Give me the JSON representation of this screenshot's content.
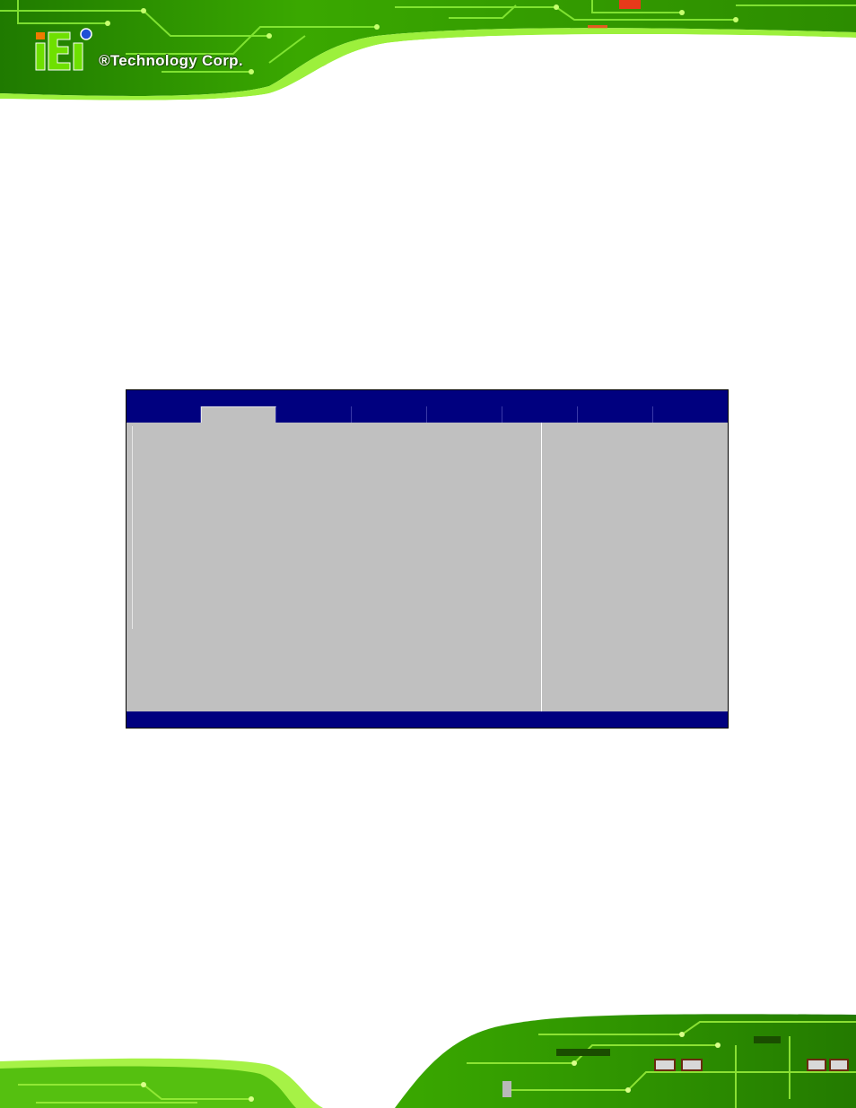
{
  "header": {
    "logo_mark": "iEi",
    "company": "®Technology Corp."
  },
  "bios": {
    "title": "",
    "tabs": [
      {
        "label": ""
      },
      {
        "label": ""
      },
      {
        "label": ""
      },
      {
        "label": ""
      },
      {
        "label": ""
      },
      {
        "label": ""
      },
      {
        "label": ""
      }
    ],
    "active_tab_index": 1,
    "status_text": ""
  },
  "colors": {
    "bios_blue": "#00007f",
    "bios_gray": "#c0c0c0",
    "pcb_green": "#5fcf10",
    "logo_orange": "#f07a00",
    "logo_blue": "#1f4fd6"
  },
  "icons": {
    "logo": "iei-logo-icon"
  }
}
